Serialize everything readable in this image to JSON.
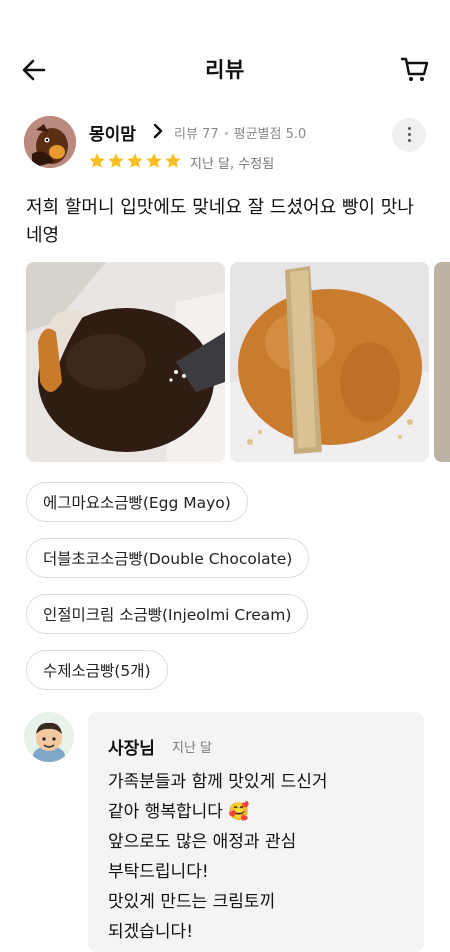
{
  "header": {
    "title": "리뷰"
  },
  "review": {
    "user_name": "몽이맘",
    "review_count": "리뷰 77",
    "rating_label": "평균별점 5.0",
    "stars": 5,
    "date": "지난 달, 수정됨",
    "text": "저희 할머니 입맛에도 맞네요 잘 드셨어요 빵이 맛나네영",
    "photos": [
      "chocolate-bread-photo",
      "injeolmi-bread-photo",
      "third-photo-partial"
    ],
    "menu_items": [
      "에그마요소금빵(Egg Mayo)",
      "더블초코소금빵(Double Chocolate)",
      "인절미크림 소금빵(Injeolmi Cream)",
      "수제소금빵(5개)"
    ]
  },
  "reply": {
    "name": "사장님",
    "date": "지난 달",
    "text": "가족분들과 함께 맛있게 드신거\n같아 행복합니다 🥰\n앞으로도 많은 애정과 관심\n부탁드립니다!\n맛있게 만드는 크림토끼\n되겠습니다!"
  },
  "colors": {
    "star": "#fbbf24",
    "chip_border": "#dcdcdc",
    "reply_bg": "#f4f4f6"
  }
}
